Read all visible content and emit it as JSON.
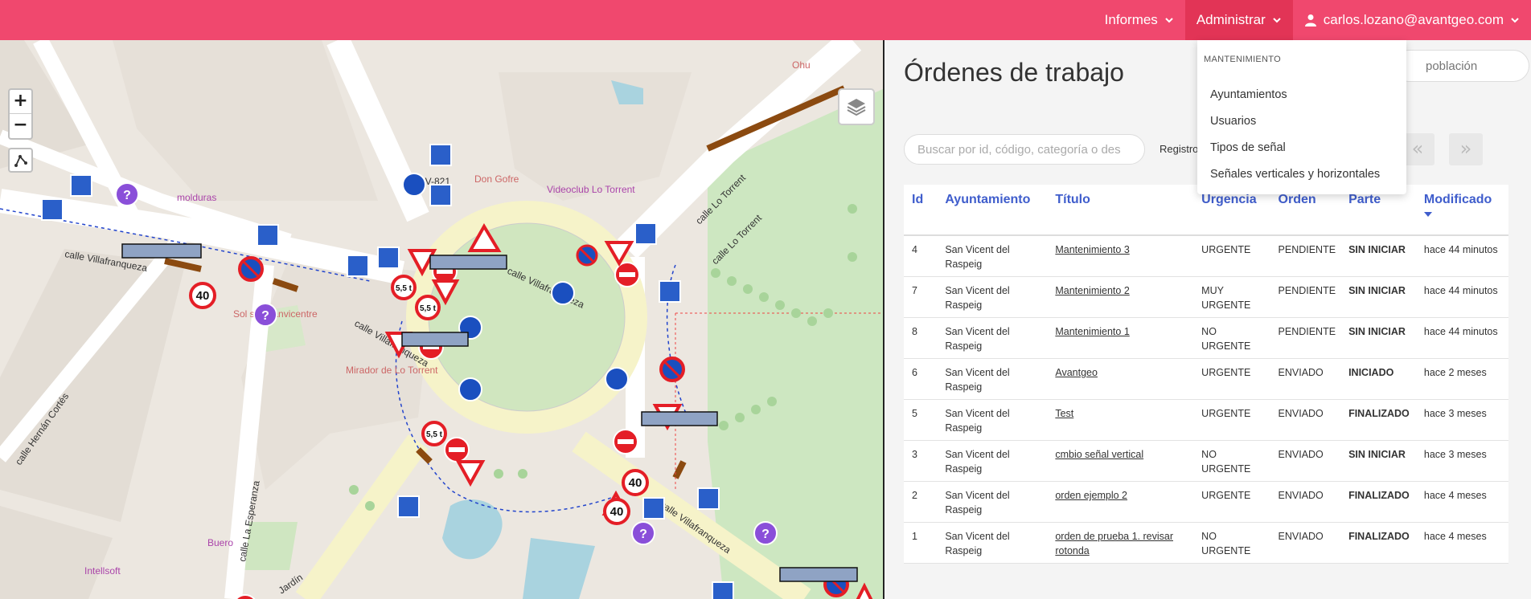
{
  "nav": {
    "informes": "Informes",
    "administrar": "Administrar",
    "user_email": "carlos.lozano@avantgeo.com"
  },
  "dropdown": {
    "header": "MANTENIMIENTO",
    "items": [
      "Ayuntamientos",
      "Usuarios",
      "Tipos de señal",
      "Señales verticales y horizontales"
    ]
  },
  "map": {
    "zoom_in": "+",
    "zoom_out": "−",
    "labels": [
      {
        "text": "calle Villafranqueza"
      },
      {
        "text": "calle Villafranqueza"
      },
      {
        "text": "calle Lo Torrent"
      },
      {
        "text": "calle Lo Torrent"
      },
      {
        "text": "calle Hernán Cortés"
      },
      {
        "text": "calle La Esperanza"
      },
      {
        "text": "calle Villafranqueza"
      },
      {
        "text": "CV-821"
      },
      {
        "text": "Don Gofre"
      },
      {
        "text": "Videoclub Lo Torrent"
      },
      {
        "text": "Sol san sanvicentre"
      },
      {
        "text": "Mirador de Lo Torrent"
      },
      {
        "text": "molduras"
      },
      {
        "text": "Buero"
      },
      {
        "text": "Intellsoft"
      },
      {
        "text": "Ohu"
      },
      {
        "text": "calle Villafranqueza"
      },
      {
        "text": "Jardín"
      }
    ]
  },
  "panel": {
    "title": "Órdenes de trabajo",
    "search_placeholder": "Buscar por id, código, categoría o des",
    "poblacion_placeholder": "población",
    "registros_label": "Registros",
    "prev_label": "«",
    "next_label": "»",
    "columns": [
      "Id",
      "Ayuntamiento",
      "Título",
      "Urgencia",
      "Orden",
      "Parte",
      "Modificado"
    ],
    "rows": [
      {
        "id": "4",
        "ayuntamiento": "San Vicent del Raspeig",
        "titulo": "Mantenimiento 3",
        "urgencia": "URGENTE",
        "orden": "PENDIENTE",
        "parte": "SIN INICIAR",
        "modificado": "hace 44 minutos"
      },
      {
        "id": "7",
        "ayuntamiento": "San Vicent del Raspeig",
        "titulo": "Mantenimiento 2",
        "urgencia": "MUY URGENTE",
        "orden": "PENDIENTE",
        "parte": "SIN INICIAR",
        "modificado": "hace 44 minutos"
      },
      {
        "id": "8",
        "ayuntamiento": "San Vicent del Raspeig",
        "titulo": "Mantenimiento 1",
        "urgencia": "NO URGENTE",
        "orden": "PENDIENTE",
        "parte": "SIN INICIAR",
        "modificado": "hace 44 minutos"
      },
      {
        "id": "6",
        "ayuntamiento": "San Vicent del Raspeig",
        "titulo": "Avantgeo",
        "urgencia": "URGENTE",
        "orden": "ENVIADO",
        "parte": "INICIADO",
        "modificado": "hace 2 meses"
      },
      {
        "id": "5",
        "ayuntamiento": "San Vicent del Raspeig",
        "titulo": "Test",
        "urgencia": "URGENTE",
        "orden": "ENVIADO",
        "parte": "FINALIZADO",
        "modificado": "hace 3 meses"
      },
      {
        "id": "3",
        "ayuntamiento": "San Vicent del Raspeig",
        "titulo": "cmbio señal vertical",
        "urgencia": "NO URGENTE",
        "orden": "ENVIADO",
        "parte": "SIN INICIAR",
        "modificado": "hace 3 meses"
      },
      {
        "id": "2",
        "ayuntamiento": "San Vicent del Raspeig",
        "titulo": "orden ejemplo 2",
        "urgencia": "URGENTE",
        "orden": "ENVIADO",
        "parte": "FINALIZADO",
        "modificado": "hace 4 meses"
      },
      {
        "id": "1",
        "ayuntamiento": "San Vicent del Raspeig",
        "titulo": "orden de prueba 1. revisar rotonda",
        "urgencia": "NO URGENTE",
        "orden": "ENVIADO",
        "parte": "FINALIZADO",
        "modificado": "hace 4 meses"
      }
    ]
  },
  "colors": {
    "navbar": "#f0486e",
    "navbar_active": "#e23456",
    "header_blue": "#3f5dcc",
    "finalizado": "#2ecc71",
    "iniciado": "#3f5dcc"
  }
}
